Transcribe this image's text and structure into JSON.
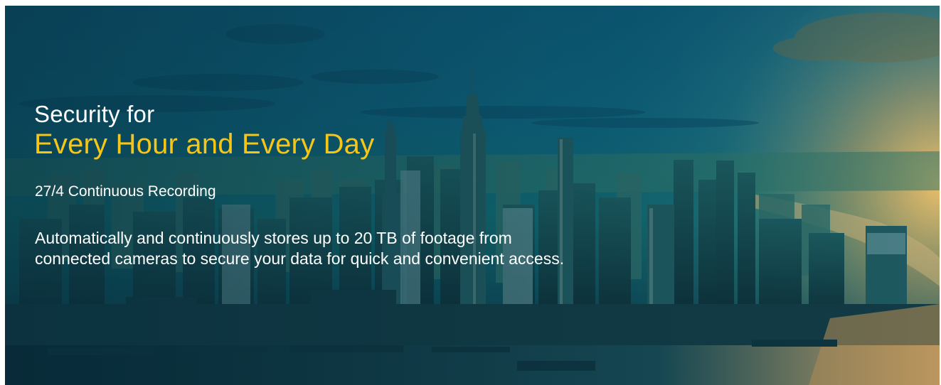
{
  "banner": {
    "headline_line1": "Security for",
    "headline_line2": "Every Hour and Every Day",
    "subtitle": "27/4 Continuous Recording",
    "description": "Automatically and continuously stores up to 20 TB of footage from connected cameras to secure your data for quick and convenient access."
  },
  "colors": {
    "highlight": "#f5c518",
    "text": "#ffffff",
    "sky": "#0d5f79",
    "sun": "#f5b04a"
  }
}
